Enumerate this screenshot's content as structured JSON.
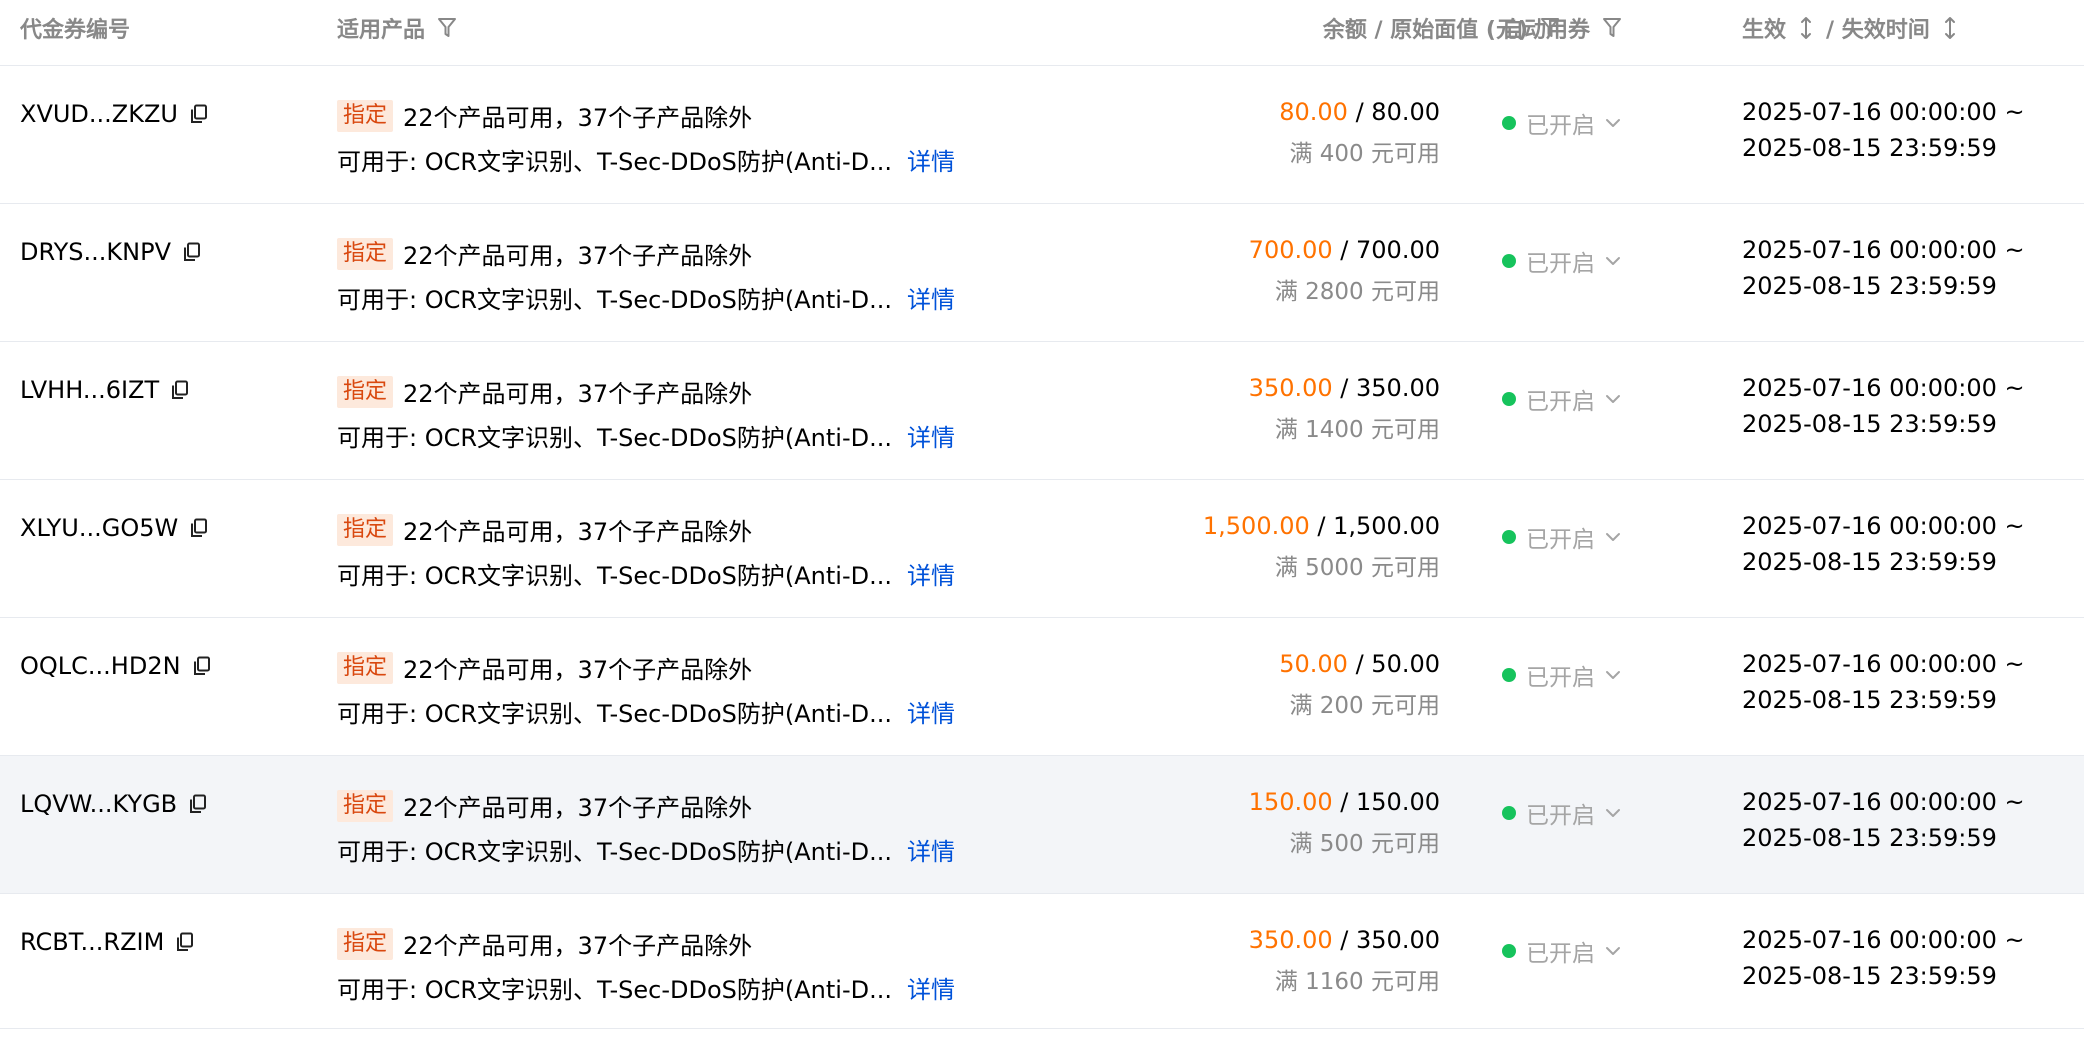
{
  "colors": {
    "balance": "#ff7200",
    "tag_bg": "#fde9dc",
    "tag_text": "#d9480f",
    "link": "#0052d9",
    "status_dot": "#16c35c",
    "header_text": "#888888",
    "row_hover_bg": "#f3f5f8"
  },
  "header": {
    "code": "代金券编号",
    "product": "适用产品",
    "amount": "余额 / 原始面值 (元)",
    "auto": "自动用券",
    "time_start": "生效",
    "time_end": "/ 失效时间"
  },
  "icons": {
    "filter": "filter-icon",
    "sort": "sort-icon",
    "copy": "copy-icon",
    "chevron": "chevron-down-icon"
  },
  "rows": [
    {
      "code": "XVUD...ZKZU",
      "tag": "指定",
      "product_summary": "22个产品可用，37个子产品除外",
      "product_detail": "可用于: OCR文字识别、T-Sec-DDoS防护(Anti-D...",
      "detail_link": "详情",
      "balance": "80.00",
      "face_value": "/ 80.00",
      "threshold": "满 400 元可用",
      "auto_status": "已开启",
      "start_time": "2025-07-16 00:00:00 ~",
      "end_time": "2025-08-15 23:59:59"
    },
    {
      "code": "DRYS...KNPV",
      "tag": "指定",
      "product_summary": "22个产品可用，37个子产品除外",
      "product_detail": "可用于: OCR文字识别、T-Sec-DDoS防护(Anti-D...",
      "detail_link": "详情",
      "balance": "700.00",
      "face_value": "/ 700.00",
      "threshold": "满 2800 元可用",
      "auto_status": "已开启",
      "start_time": "2025-07-16 00:00:00 ~",
      "end_time": "2025-08-15 23:59:59"
    },
    {
      "code": "LVHH...6IZT",
      "tag": "指定",
      "product_summary": "22个产品可用，37个子产品除外",
      "product_detail": "可用于: OCR文字识别、T-Sec-DDoS防护(Anti-D...",
      "detail_link": "详情",
      "balance": "350.00",
      "face_value": "/ 350.00",
      "threshold": "满 1400 元可用",
      "auto_status": "已开启",
      "start_time": "2025-07-16 00:00:00 ~",
      "end_time": "2025-08-15 23:59:59"
    },
    {
      "code": "XLYU...GO5W",
      "tag": "指定",
      "product_summary": "22个产品可用，37个子产品除外",
      "product_detail": "可用于: OCR文字识别、T-Sec-DDoS防护(Anti-D...",
      "detail_link": "详情",
      "balance": "1,500.00",
      "face_value": "/ 1,500.00",
      "threshold": "满 5000 元可用",
      "auto_status": "已开启",
      "start_time": "2025-07-16 00:00:00 ~",
      "end_time": "2025-08-15 23:59:59"
    },
    {
      "code": "OQLC...HD2N",
      "tag": "指定",
      "product_summary": "22个产品可用，37个子产品除外",
      "product_detail": "可用于: OCR文字识别、T-Sec-DDoS防护(Anti-D...",
      "detail_link": "详情",
      "balance": "50.00",
      "face_value": "/ 50.00",
      "threshold": "满 200 元可用",
      "auto_status": "已开启",
      "start_time": "2025-07-16 00:00:00 ~",
      "end_time": "2025-08-15 23:59:59"
    },
    {
      "code": "LQVW...KYGB",
      "tag": "指定",
      "product_summary": "22个产品可用，37个子产品除外",
      "product_detail": "可用于: OCR文字识别、T-Sec-DDoS防护(Anti-D...",
      "detail_link": "详情",
      "balance": "150.00",
      "face_value": "/ 150.00",
      "threshold": "满 500 元可用",
      "auto_status": "已开启",
      "start_time": "2025-07-16 00:00:00 ~",
      "end_time": "2025-08-15 23:59:59"
    },
    {
      "code": "RCBT...RZIM",
      "tag": "指定",
      "product_summary": "22个产品可用，37个子产品除外",
      "product_detail": "可用于: OCR文字识别、T-Sec-DDoS防护(Anti-D...",
      "detail_link": "详情",
      "balance": "350.00",
      "face_value": "/ 350.00",
      "threshold": "满 1160 元可用",
      "auto_status": "已开启",
      "start_time": "2025-07-16 00:00:00 ~",
      "end_time": "2025-08-15 23:59:59"
    }
  ]
}
